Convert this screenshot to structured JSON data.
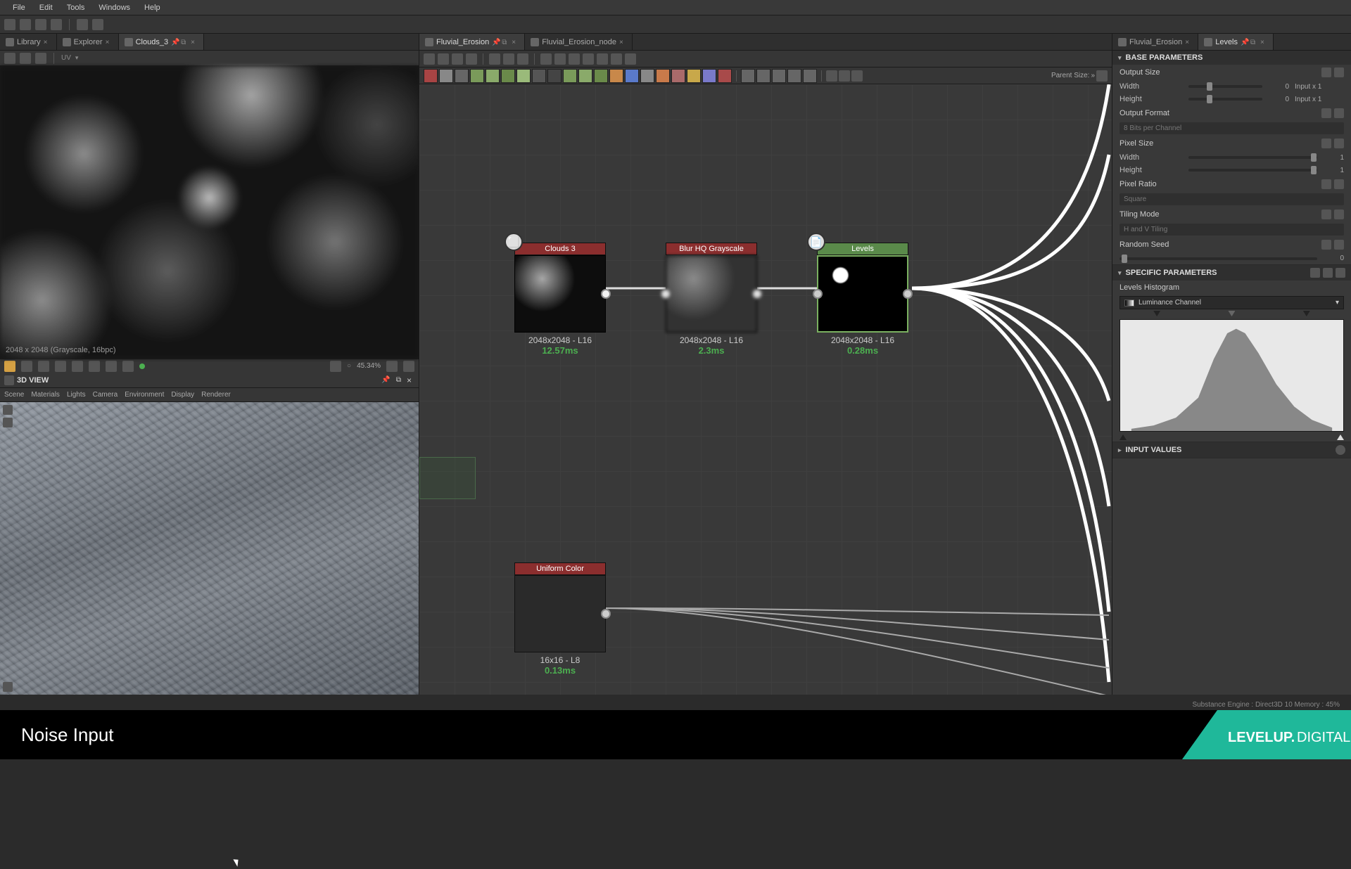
{
  "menu": {
    "items": [
      "File",
      "Edit",
      "Tools",
      "Windows",
      "Help"
    ]
  },
  "left_tabs": [
    {
      "label": "Library",
      "active": false
    },
    {
      "label": "Explorer",
      "active": false
    },
    {
      "label": "Clouds_3",
      "active": true
    }
  ],
  "center_tabs": [
    {
      "label": "Fluvial_Erosion",
      "active": true
    },
    {
      "label": "Fluvial_Erosion_node",
      "active": false
    }
  ],
  "right_tabs": [
    {
      "label": "Fluvial_Erosion",
      "active": false
    },
    {
      "label": "Levels",
      "active": true
    }
  ],
  "view2d": {
    "info": "2048 x 2048 (Grayscale, 16bpc)",
    "zoom": "45.34%",
    "uv_label": "UV"
  },
  "view3d": {
    "title": "3D VIEW",
    "menu": [
      "Scene",
      "Materials",
      "Lights",
      "Camera",
      "Environment",
      "Display",
      "Renderer"
    ]
  },
  "graph": {
    "parent_size_label": "Parent Size:",
    "nodes": {
      "clouds": {
        "title": "Clouds 3",
        "info": "2048x2048 - L16",
        "time": "12.57ms"
      },
      "blur": {
        "title": "Blur HQ Grayscale",
        "info": "2048x2048 - L16",
        "time": "2.3ms"
      },
      "levels": {
        "title": "Levels",
        "info": "2048x2048 - L16",
        "time": "0.28ms"
      },
      "uniform": {
        "title": "Uniform Color",
        "info": "16x16 - L8",
        "time": "0.13ms"
      }
    }
  },
  "properties": {
    "base_params": {
      "title": "BASE PARAMETERS",
      "output_size": {
        "label": "Output Size",
        "width_label": "Width",
        "height_label": "Height",
        "width_val": "0",
        "height_val": "0",
        "width_text": "Input x 1",
        "height_text": "Input x 1"
      },
      "output_format": {
        "label": "Output Format",
        "value": "8 Bits per Channel"
      },
      "pixel_size": {
        "label": "Pixel Size",
        "width_label": "Width",
        "height_label": "Height",
        "width_val": "1",
        "height_val": "1"
      },
      "pixel_ratio": {
        "label": "Pixel Ratio",
        "value": "Square"
      },
      "tiling_mode": {
        "label": "Tiling Mode",
        "value": "H and V Tiling"
      },
      "random_seed": {
        "label": "Random Seed",
        "value": "0"
      }
    },
    "specific_params": {
      "title": "SPECIFIC PARAMETERS",
      "histogram_label": "Levels Histogram",
      "channel": "Luminance Channel"
    },
    "input_values": {
      "title": "INPUT VALUES"
    }
  },
  "status": "Substance Engine : Direct3D 10  Memory : 45%",
  "footer": {
    "title": "Noise Input",
    "logo_text": "LEVELUP.DIGITAL"
  }
}
